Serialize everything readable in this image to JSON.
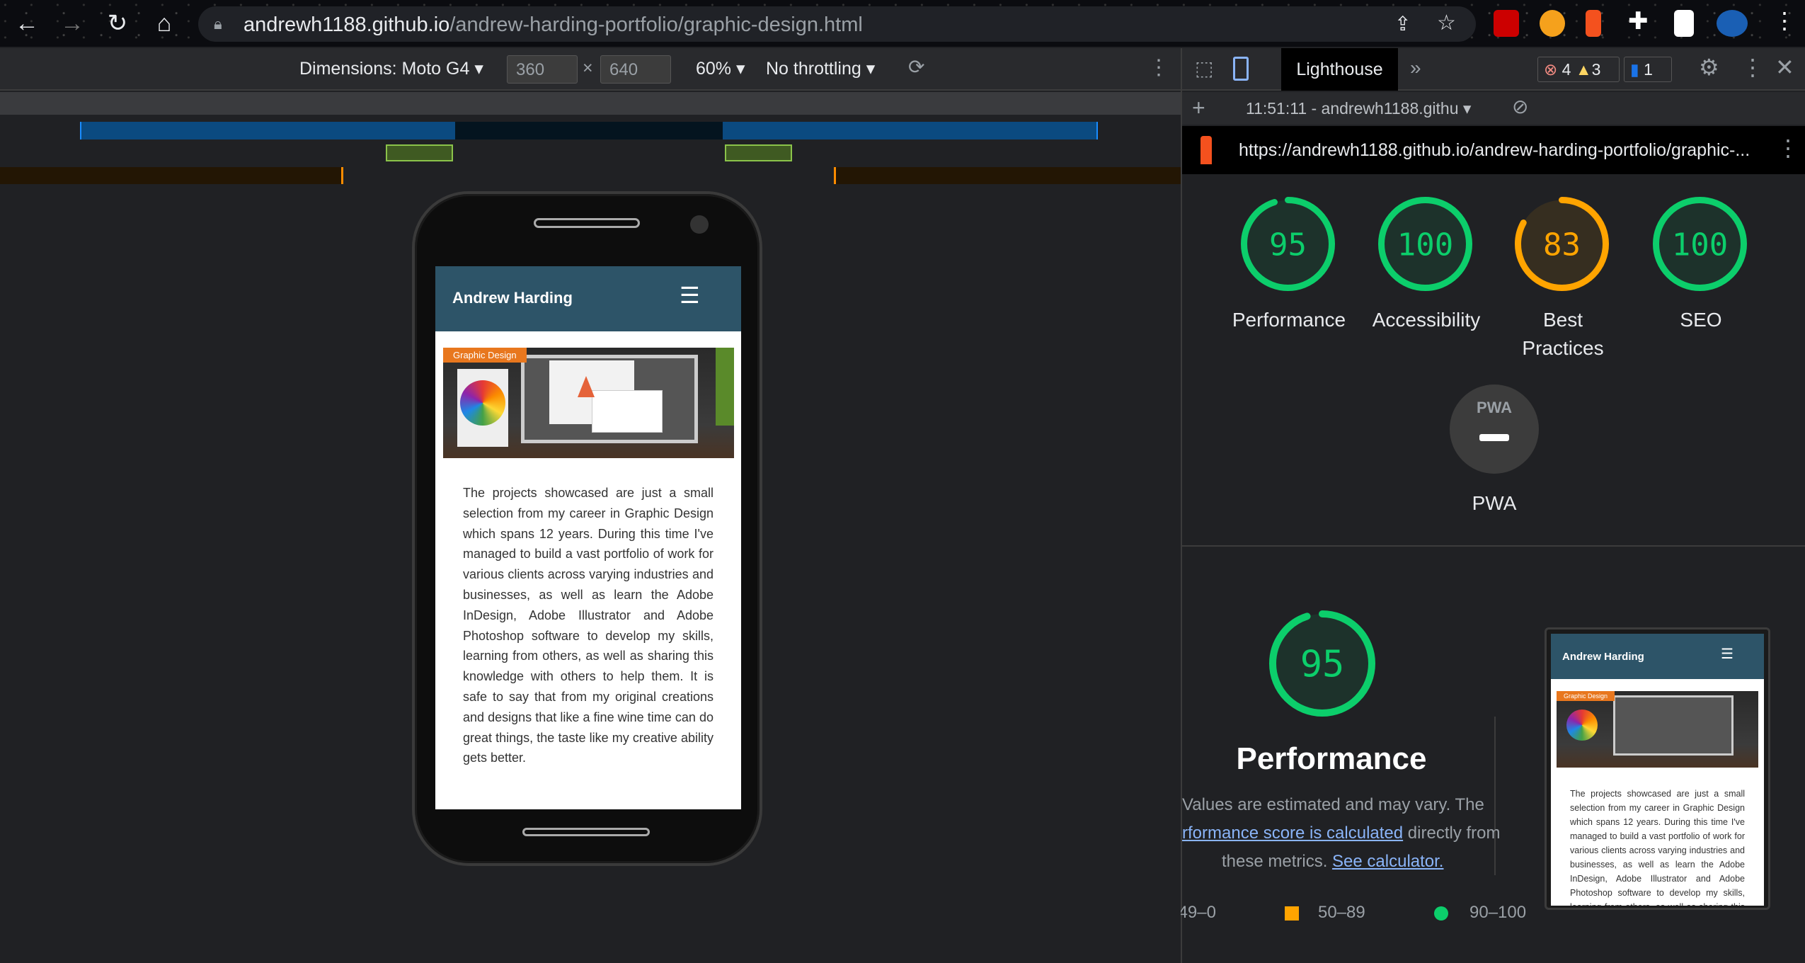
{
  "browser": {
    "url_host": "andrewh1188.github.io",
    "url_path": "/andrew-harding-portfolio/graphic-design.html"
  },
  "device_toolbar": {
    "dimensions": "Dimensions: Moto G4",
    "width": "360",
    "height": "640",
    "times": "×",
    "zoom": "60%",
    "throttling": "No throttling"
  },
  "devtools": {
    "tab": "Lighthouse",
    "errors": "4",
    "warnings": "3",
    "messages": "1",
    "report_select": "11:51:11 - andrewh1188.githu",
    "report_url": "https://andrewh1188.github.io/andrew-harding-portfolio/graphic-..."
  },
  "colors": {
    "pass": "#0cce6b",
    "average": "#ffa400",
    "header": "#2d5468"
  },
  "scores": [
    {
      "label": "Performance",
      "value": 95,
      "label2": ""
    },
    {
      "label": "Accessibility",
      "value": 100,
      "label2": ""
    },
    {
      "label": "Best",
      "value": 83,
      "label2": "Practices"
    },
    {
      "label": "SEO",
      "value": 100,
      "label2": ""
    }
  ],
  "pwa": {
    "badge": "PWA",
    "label": "PWA"
  },
  "performance": {
    "score": "95",
    "title": "Performance",
    "desc1": "Values are estimated and may vary. The",
    "link1": "rformance score is calculated",
    "desc2": " directly from",
    "desc3": "these metrics. ",
    "link2": "See calculator.",
    "legend": [
      "0–49",
      "50–89",
      "90–100"
    ]
  },
  "site": {
    "title": "Andrew Harding",
    "menu_icon": "☰",
    "tag": "Graphic Design",
    "text": "The projects showcased are just a small selection from my career in Graphic Design which spans 12 years. During this time I've managed to build a vast portfolio of work for various clients across varying industries and businesses, as well as learn the Adobe InDesign, Adobe Illustrator and Adobe Photoshop software to develop my skills, learning from others, as well as sharing this knowledge with others to help them. It is safe to say that from my original creations and designs that like a fine wine time can do great things, the taste like my creative ability gets better."
  }
}
